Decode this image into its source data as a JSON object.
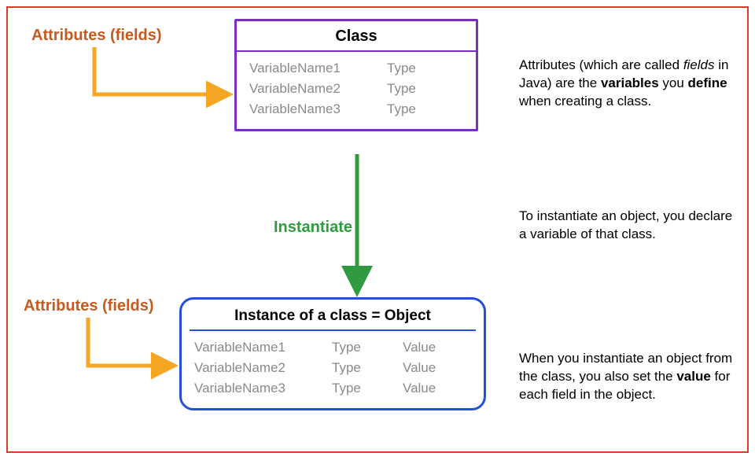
{
  "labels": {
    "attr_top": "Attributes (fields)",
    "attr_bottom": "Attributes (fields)",
    "instantiate": "Instantiate"
  },
  "class_box": {
    "title": "Class",
    "rows": [
      {
        "name": "VariableName1",
        "type": "Type"
      },
      {
        "name": "VariableName2",
        "type": "Type"
      },
      {
        "name": "VariableName3",
        "type": "Type"
      }
    ]
  },
  "object_box": {
    "title": "Instance of a class = Object",
    "rows": [
      {
        "name": "VariableName1",
        "type": "Type",
        "value": "Value"
      },
      {
        "name": "VariableName2",
        "type": "Type",
        "value": "Value"
      },
      {
        "name": "VariableName3",
        "type": "Type",
        "value": "Value"
      }
    ]
  },
  "desc": {
    "p1_a": "Attributes (which are called ",
    "p1_i": "fields",
    "p1_b": " in Java) are the ",
    "p1_s1": "variables",
    "p1_c": " you ",
    "p1_s2": "define",
    "p1_d": " when creating a class.",
    "p2": "To instantiate an object, you declare a variable of that class.",
    "p3_a": "When you instantiate an object from the class, you also set the ",
    "p3_s1": "value",
    "p3_b": " for each field in the object."
  },
  "colors": {
    "frame": "#e43a2c",
    "class_border": "#7b2fbf",
    "object_border": "#2450d8",
    "label_orange": "#c85a1e",
    "green": "#2f9a3f",
    "arrow_yellow": "#f5a623"
  }
}
